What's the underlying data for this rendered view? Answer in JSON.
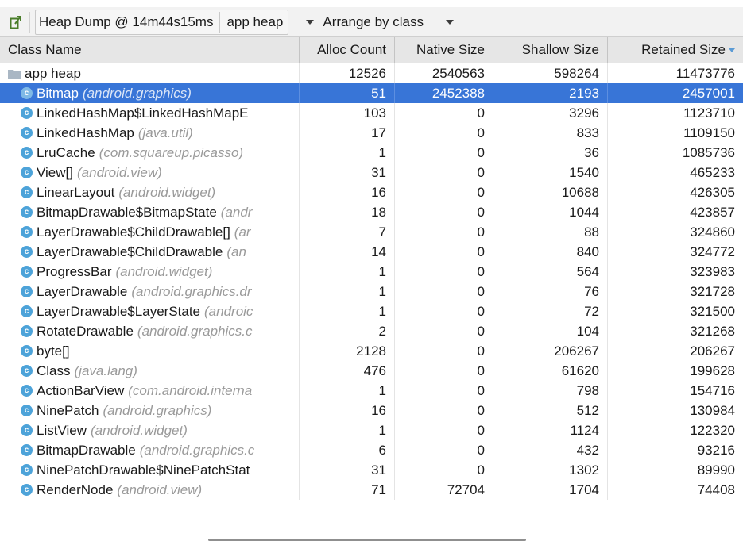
{
  "toolbar": {
    "export_icon": "export-icon",
    "dump_label": "Heap Dump @ 14m44s15ms",
    "heap_label": "app heap",
    "arrange_label": "Arrange by class"
  },
  "columns": [
    "Class Name",
    "Alloc Count",
    "Native Size",
    "Shallow Size",
    "Retained Size"
  ],
  "sort": {
    "column": "Retained Size",
    "direction": "descending"
  },
  "colors": {
    "selection": "#3875d7",
    "class_icon": "#4da3d9",
    "package_text": "#9a9a9a",
    "header_bg": "#e6e6e6",
    "toolbar_bg": "#f2f2f2"
  },
  "root_row": {
    "icon": "folder-icon",
    "name": "app heap",
    "alloc_count": "12526",
    "native_size": "2540563",
    "shallow_size": "598264",
    "retained_size": "11473776"
  },
  "rows": [
    {
      "name": "Bitmap",
      "package": "(android.graphics)",
      "alloc_count": "51",
      "native_size": "2452388",
      "shallow_size": "2193",
      "retained_size": "2457001",
      "selected": true
    },
    {
      "name": "LinkedHashMap$LinkedHashMapE",
      "package": "",
      "alloc_count": "103",
      "native_size": "0",
      "shallow_size": "3296",
      "retained_size": "1123710"
    },
    {
      "name": "LinkedHashMap",
      "package": "(java.util)",
      "alloc_count": "17",
      "native_size": "0",
      "shallow_size": "833",
      "retained_size": "1109150"
    },
    {
      "name": "LruCache",
      "package": "(com.squareup.picasso)",
      "alloc_count": "1",
      "native_size": "0",
      "shallow_size": "36",
      "retained_size": "1085736"
    },
    {
      "name": "View[]",
      "package": "(android.view)",
      "alloc_count": "31",
      "native_size": "0",
      "shallow_size": "1540",
      "retained_size": "465233"
    },
    {
      "name": "LinearLayout",
      "package": "(android.widget)",
      "alloc_count": "16",
      "native_size": "0",
      "shallow_size": "10688",
      "retained_size": "426305"
    },
    {
      "name": "BitmapDrawable$BitmapState",
      "package": "(andr",
      "alloc_count": "18",
      "native_size": "0",
      "shallow_size": "1044",
      "retained_size": "423857"
    },
    {
      "name": "LayerDrawable$ChildDrawable[]",
      "package": "(ar",
      "alloc_count": "7",
      "native_size": "0",
      "shallow_size": "88",
      "retained_size": "324860"
    },
    {
      "name": "LayerDrawable$ChildDrawable",
      "package": "(an",
      "alloc_count": "14",
      "native_size": "0",
      "shallow_size": "840",
      "retained_size": "324772"
    },
    {
      "name": "ProgressBar",
      "package": "(android.widget)",
      "alloc_count": "1",
      "native_size": "0",
      "shallow_size": "564",
      "retained_size": "323983"
    },
    {
      "name": "LayerDrawable",
      "package": "(android.graphics.dr",
      "alloc_count": "1",
      "native_size": "0",
      "shallow_size": "76",
      "retained_size": "321728"
    },
    {
      "name": "LayerDrawable$LayerState",
      "package": "(androic",
      "alloc_count": "1",
      "native_size": "0",
      "shallow_size": "72",
      "retained_size": "321500"
    },
    {
      "name": "RotateDrawable",
      "package": "(android.graphics.c",
      "alloc_count": "2",
      "native_size": "0",
      "shallow_size": "104",
      "retained_size": "321268"
    },
    {
      "name": "byte[]",
      "package": "",
      "alloc_count": "2128",
      "native_size": "0",
      "shallow_size": "206267",
      "retained_size": "206267"
    },
    {
      "name": "Class",
      "package": "(java.lang)",
      "alloc_count": "476",
      "native_size": "0",
      "shallow_size": "61620",
      "retained_size": "199628"
    },
    {
      "name": "ActionBarView",
      "package": "(com.android.interna",
      "alloc_count": "1",
      "native_size": "0",
      "shallow_size": "798",
      "retained_size": "154716"
    },
    {
      "name": "NinePatch",
      "package": "(android.graphics)",
      "alloc_count": "16",
      "native_size": "0",
      "shallow_size": "512",
      "retained_size": "130984"
    },
    {
      "name": "ListView",
      "package": "(android.widget)",
      "alloc_count": "1",
      "native_size": "0",
      "shallow_size": "1124",
      "retained_size": "122320"
    },
    {
      "name": "BitmapDrawable",
      "package": "(android.graphics.c",
      "alloc_count": "6",
      "native_size": "0",
      "shallow_size": "432",
      "retained_size": "93216"
    },
    {
      "name": "NinePatchDrawable$NinePatchStat",
      "package": "",
      "alloc_count": "31",
      "native_size": "0",
      "shallow_size": "1302",
      "retained_size": "89990"
    },
    {
      "name": "RenderNode",
      "package": "(android.view)",
      "alloc_count": "71",
      "native_size": "72704",
      "shallow_size": "1704",
      "retained_size": "74408"
    }
  ],
  "class_icon_letter": "c"
}
